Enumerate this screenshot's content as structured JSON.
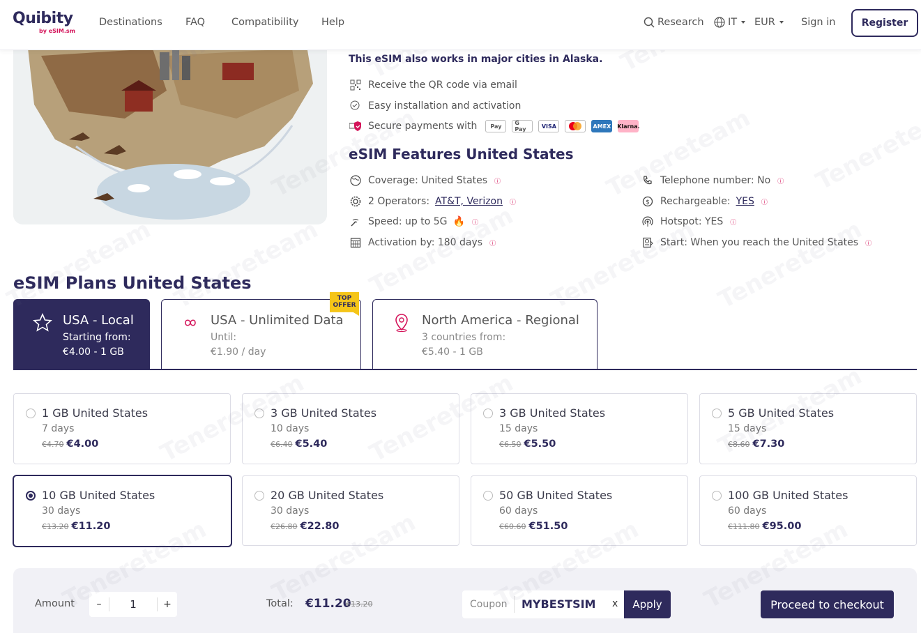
{
  "brand": {
    "name": "Quibity",
    "sub": "by eSIM.sm",
    "accent": "#d4145a",
    "primary": "#2e2a5c"
  },
  "nav": {
    "items": [
      "Destinations",
      "FAQ",
      "Compatibility",
      "Help"
    ],
    "research": "Research",
    "language": "IT",
    "currency": "EUR",
    "signin": "Sign in",
    "register": "Register"
  },
  "info": {
    "alaska_note": "This eSIM also works in major cities in Alaska.",
    "qr": "Receive the QR code via email",
    "install": "Easy installation and activation",
    "payments": "Secure payments with",
    "payment_methods": [
      "Pay",
      "G Pay",
      "VISA",
      "MC",
      "AMEX",
      "Klarna."
    ]
  },
  "features": {
    "title": "eSIM Features United States",
    "coverage": "Coverage: United States",
    "operators_prefix": "2 Operators:",
    "operators": "AT&T, Verizon",
    "speed": "Speed: up to 5G",
    "activation": "Activation by: 180 days",
    "telephone": "Telephone number: No",
    "rechargeable_prefix": "Rechargeable:",
    "rechargeable": "YES",
    "hotspot": "Hotspot: YES",
    "start": "Start: When you reach the United States"
  },
  "plans": {
    "title": "eSIM Plans United States",
    "top_offer_1": "TOP",
    "top_offer_2": "OFFER",
    "tabs": [
      {
        "title": "USA - Local",
        "sub": "Starting from:",
        "sub2": "€4.00 - 1 GB"
      },
      {
        "title": "USA - Unlimited Data",
        "sub": "Until:",
        "sub2": "€1.90 / day"
      },
      {
        "title": "North America - Regional",
        "sub": "3 countries from:",
        "sub2": "€5.40 - 1 GB"
      }
    ],
    "cards": [
      {
        "title": "1 GB United States",
        "days": "7 days",
        "old": "€4.70",
        "new": "€4.00"
      },
      {
        "title": "3 GB United States",
        "days": "10 days",
        "old": "€6.40",
        "new": "€5.40"
      },
      {
        "title": "3 GB United States",
        "days": "15 days",
        "old": "€6.50",
        "new": "€5.50"
      },
      {
        "title": "5 GB United States",
        "days": "15 days",
        "old": "€8.60",
        "new": "€7.30"
      },
      {
        "title": "10 GB United States",
        "days": "30 days",
        "old": "€13.20",
        "new": "€11.20"
      },
      {
        "title": "20 GB United States",
        "days": "30 days",
        "old": "€26.80",
        "new": "€22.80"
      },
      {
        "title": "50 GB United States",
        "days": "60 days",
        "old": "€60.60",
        "new": "€51.50"
      },
      {
        "title": "100 GB United States",
        "days": "60 days",
        "old": "€111.80",
        "new": "€95.00"
      }
    ],
    "selected_index": 4
  },
  "checkout": {
    "amount_label": "Amount",
    "minus": "–",
    "quantity": "1",
    "plus": "+",
    "total_label": "Total:",
    "total_new": "€11.20",
    "total_old": "€13.20",
    "coupon_label": "Coupon",
    "coupon_value": "MYBESTSIM",
    "coupon_clear": "x",
    "apply": "Apply",
    "proceed": "Proceed to checkout"
  },
  "watermark": "Tenereteam"
}
